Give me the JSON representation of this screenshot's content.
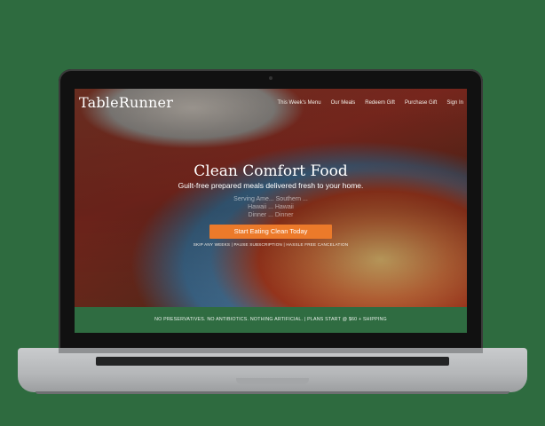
{
  "brand": {
    "name": "TableRunner"
  },
  "nav": {
    "items": [
      "This Week's Menu",
      "Our Meals",
      "Redeem Gift",
      "Purchase Gift",
      "Sign In"
    ]
  },
  "hero": {
    "title": "Clean Comfort Food",
    "subtitle": "Guilt-free prepared meals delivered fresh to your home.",
    "faded_lines": [
      "Serving Ame... Southern ...",
      "Hawaii ... Hawaii",
      "Dinner ... Dinner"
    ],
    "cta_label": "Start Eating Clean Today",
    "note": "SKIP ANY WEEKS | PAUSE SUBSCRIPTION | HASSLE FREE CANCELATION"
  },
  "banner": {
    "text": "NO PRESERVATIVES. NO ANTIBIOTICS. NOTHING ARTIFICIAL. | PLANS START @ $60 + SHIPPING"
  },
  "colors": {
    "background": "#2e6b3f",
    "cta": "#ec7a2a",
    "banner": "#2f6c41"
  }
}
